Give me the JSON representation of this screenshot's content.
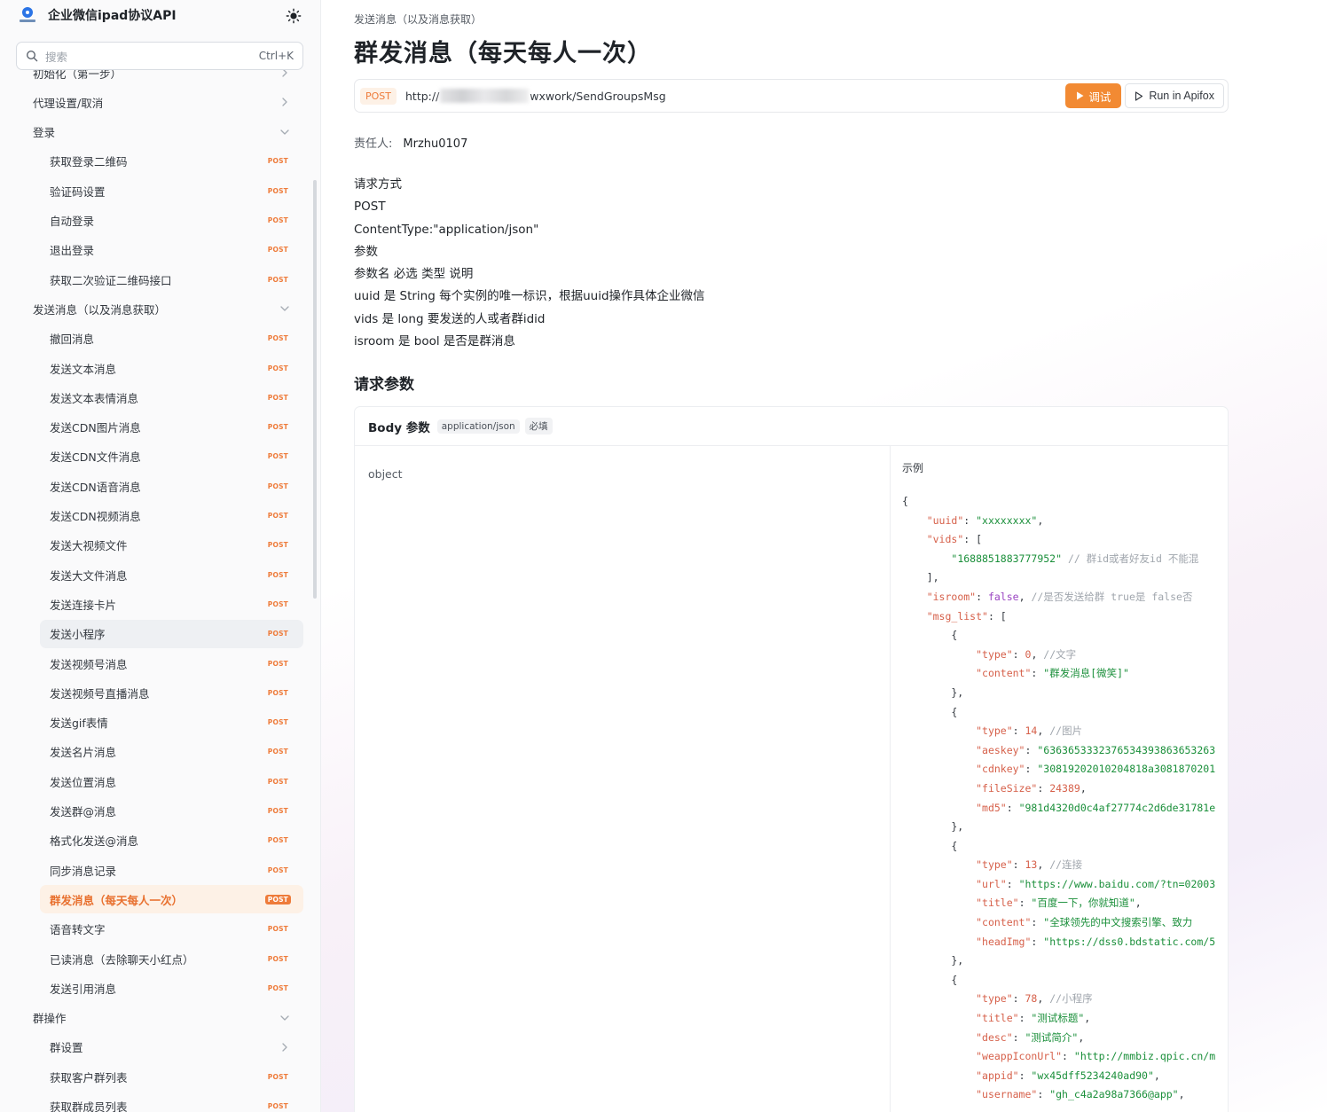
{
  "app": {
    "title": "企业微信ipad协议API"
  },
  "search": {
    "placeholder": "搜索",
    "shortcut": "Ctrl+K"
  },
  "sidebar": {
    "method_badge": "POST",
    "items": [
      {
        "label": "初始化（第一步）",
        "kind": "group",
        "chevron": "right"
      },
      {
        "label": "代理设置/取消",
        "kind": "group",
        "chevron": "right"
      },
      {
        "label": "登录",
        "kind": "group",
        "chevron": "down"
      },
      {
        "label": "获取登录二维码",
        "kind": "sub"
      },
      {
        "label": "验证码设置",
        "kind": "sub"
      },
      {
        "label": "自动登录",
        "kind": "sub"
      },
      {
        "label": "退出登录",
        "kind": "sub"
      },
      {
        "label": "获取二次验证二维码接口",
        "kind": "sub"
      },
      {
        "label": "发送消息（以及消息获取）",
        "kind": "group",
        "chevron": "down"
      },
      {
        "label": "撤回消息",
        "kind": "sub"
      },
      {
        "label": "发送文本消息",
        "kind": "sub"
      },
      {
        "label": "发送文本表情消息",
        "kind": "sub"
      },
      {
        "label": "发送CDN图片消息",
        "kind": "sub"
      },
      {
        "label": "发送CDN文件消息",
        "kind": "sub"
      },
      {
        "label": "发送CDN语音消息",
        "kind": "sub"
      },
      {
        "label": "发送CDN视频消息",
        "kind": "sub"
      },
      {
        "label": "发送大视频文件",
        "kind": "sub"
      },
      {
        "label": "发送大文件消息",
        "kind": "sub"
      },
      {
        "label": "发送连接卡片",
        "kind": "sub"
      },
      {
        "label": "发送小程序",
        "kind": "sub",
        "state": "hover"
      },
      {
        "label": "发送视频号消息",
        "kind": "sub"
      },
      {
        "label": "发送视频号直播消息",
        "kind": "sub"
      },
      {
        "label": "发送gif表情",
        "kind": "sub"
      },
      {
        "label": "发送名片消息",
        "kind": "sub"
      },
      {
        "label": "发送位置消息",
        "kind": "sub"
      },
      {
        "label": "发送群@消息",
        "kind": "sub"
      },
      {
        "label": "格式化发送@消息",
        "kind": "sub"
      },
      {
        "label": "同步消息记录",
        "kind": "sub"
      },
      {
        "label": "群发消息（每天每人一次）",
        "kind": "sub",
        "state": "active"
      },
      {
        "label": "语音转文字",
        "kind": "sub"
      },
      {
        "label": "已读消息（去除聊天小红点）",
        "kind": "sub"
      },
      {
        "label": "发送引用消息",
        "kind": "sub"
      },
      {
        "label": "群操作",
        "kind": "group",
        "chevron": "down"
      },
      {
        "label": "群设置",
        "kind": "subgroup",
        "chevron": "right"
      },
      {
        "label": "获取客户群列表",
        "kind": "sub"
      },
      {
        "label": "获取群成员列表",
        "kind": "sub"
      }
    ]
  },
  "page": {
    "breadcrumb": "发送消息（以及消息获取）",
    "title": "群发消息（每天每人一次）",
    "method": "POST",
    "url_prefix": "http://",
    "url_suffix": "wxwork/SendGroupsMsg",
    "test_button": "调试",
    "run_button": "Run in Apifox",
    "owner_label": "责任人:",
    "owner_name": "Mrzhu0107",
    "description": [
      "请求方式",
      "POST",
      "ContentType:\"application/json\"",
      "参数",
      "参数名 必选 类型 说明",
      "uuid 是 String 每个实例的唯一标识，根据uuid操作具体企业微信",
      "vids 是 long 要发送的人或者群idid",
      "isroom 是 bool 是否是群消息"
    ],
    "request_params_heading": "请求参数",
    "body": {
      "title": "Body 参数",
      "content_type": "application/json",
      "required": "必填",
      "object_label": "object",
      "example_title": "示例"
    }
  },
  "example_lines": [
    [
      [
        "p",
        "{"
      ]
    ],
    [
      [
        "p",
        "    "
      ],
      [
        "k",
        "\"uuid\""
      ],
      [
        "p",
        ": "
      ],
      [
        "s",
        "\"xxxxxxxx\""
      ],
      [
        "p",
        ","
      ]
    ],
    [
      [
        "p",
        "    "
      ],
      [
        "k",
        "\"vids\""
      ],
      [
        "p",
        ": ["
      ]
    ],
    [
      [
        "p",
        "        "
      ],
      [
        "s",
        "\"1688851883777952\""
      ],
      [
        "c",
        " // 群id或者好友id 不能混"
      ]
    ],
    [
      [
        "p",
        "    ],"
      ]
    ],
    [
      [
        "p",
        "    "
      ],
      [
        "k",
        "\"isroom\""
      ],
      [
        "p",
        ": "
      ],
      [
        "b",
        "false"
      ],
      [
        "p",
        ", "
      ],
      [
        "c",
        "//是否发送给群 true是 false否"
      ]
    ],
    [
      [
        "p",
        "    "
      ],
      [
        "k",
        "\"msg_list\""
      ],
      [
        "p",
        ": ["
      ]
    ],
    [
      [
        "p",
        "        {"
      ]
    ],
    [
      [
        "p",
        "            "
      ],
      [
        "k",
        "\"type\""
      ],
      [
        "p",
        ": "
      ],
      [
        "n",
        "0"
      ],
      [
        "p",
        ", "
      ],
      [
        "c",
        "//文字"
      ]
    ],
    [
      [
        "p",
        "            "
      ],
      [
        "k",
        "\"content\""
      ],
      [
        "p",
        ": "
      ],
      [
        "s",
        "\"群发消息[微笑]\""
      ]
    ],
    [
      [
        "p",
        "        },"
      ]
    ],
    [
      [
        "p",
        "        {"
      ]
    ],
    [
      [
        "p",
        "            "
      ],
      [
        "k",
        "\"type\""
      ],
      [
        "p",
        ": "
      ],
      [
        "n",
        "14"
      ],
      [
        "p",
        ", "
      ],
      [
        "c",
        "//图片"
      ]
    ],
    [
      [
        "p",
        "            "
      ],
      [
        "k",
        "\"aeskey\""
      ],
      [
        "p",
        ": "
      ],
      [
        "s",
        "\"6363653332376534393863653263"
      ]
    ],
    [
      [
        "p",
        "            "
      ],
      [
        "k",
        "\"cdnkey\""
      ],
      [
        "p",
        ": "
      ],
      [
        "s",
        "\"30819202010204818a3081870201"
      ]
    ],
    [
      [
        "p",
        "            "
      ],
      [
        "k",
        "\"fileSize\""
      ],
      [
        "p",
        ": "
      ],
      [
        "n",
        "24389"
      ],
      [
        "p",
        ","
      ]
    ],
    [
      [
        "p",
        "            "
      ],
      [
        "k",
        "\"md5\""
      ],
      [
        "p",
        ": "
      ],
      [
        "s",
        "\"981d4320d0c4af27774c2d6de31781e"
      ]
    ],
    [
      [
        "p",
        "        },"
      ]
    ],
    [
      [
        "p",
        "        {"
      ]
    ],
    [
      [
        "p",
        "            "
      ],
      [
        "k",
        "\"type\""
      ],
      [
        "p",
        ": "
      ],
      [
        "n",
        "13"
      ],
      [
        "p",
        ", "
      ],
      [
        "c",
        "//连接"
      ]
    ],
    [
      [
        "p",
        "            "
      ],
      [
        "k",
        "\"url\""
      ],
      [
        "p",
        ": "
      ],
      [
        "s",
        "\"https://www.baidu.com/?tn=02003"
      ]
    ],
    [
      [
        "p",
        "            "
      ],
      [
        "k",
        "\"title\""
      ],
      [
        "p",
        ": "
      ],
      [
        "s",
        "\"百度一下，你就知道\""
      ],
      [
        "p",
        ","
      ]
    ],
    [
      [
        "p",
        "            "
      ],
      [
        "k",
        "\"content\""
      ],
      [
        "p",
        ": "
      ],
      [
        "s",
        "\"全球领先的中文搜索引擎、致力"
      ]
    ],
    [
      [
        "p",
        "            "
      ],
      [
        "k",
        "\"headImg\""
      ],
      [
        "p",
        ": "
      ],
      [
        "s",
        "\"https://dss0.bdstatic.com/5"
      ]
    ],
    [
      [
        "p",
        "        },"
      ]
    ],
    [
      [
        "p",
        "        {"
      ]
    ],
    [
      [
        "p",
        "            "
      ],
      [
        "k",
        "\"type\""
      ],
      [
        "p",
        ": "
      ],
      [
        "n",
        "78"
      ],
      [
        "p",
        ", "
      ],
      [
        "c",
        "//小程序"
      ]
    ],
    [
      [
        "p",
        "            "
      ],
      [
        "k",
        "\"title\""
      ],
      [
        "p",
        ": "
      ],
      [
        "s",
        "\"测试标题\""
      ],
      [
        "p",
        ","
      ]
    ],
    [
      [
        "p",
        "            "
      ],
      [
        "k",
        "\"desc\""
      ],
      [
        "p",
        ": "
      ],
      [
        "s",
        "\"测试简介\""
      ],
      [
        "p",
        ","
      ]
    ],
    [
      [
        "p",
        "            "
      ],
      [
        "k",
        "\"weappIconUrl\""
      ],
      [
        "p",
        ": "
      ],
      [
        "s",
        "\"http://mmbiz.qpic.cn/m"
      ]
    ],
    [
      [
        "p",
        "            "
      ],
      [
        "k",
        "\"appid\""
      ],
      [
        "p",
        ": "
      ],
      [
        "s",
        "\"wx45dff5234240ad90\""
      ],
      [
        "p",
        ","
      ]
    ],
    [
      [
        "p",
        "            "
      ],
      [
        "k",
        "\"username\""
      ],
      [
        "p",
        ": "
      ],
      [
        "s",
        "\"gh_c4a2a98a7366@app\""
      ],
      [
        "p",
        ","
      ]
    ]
  ],
  "colors": {
    "accent": "#f28a33",
    "post_badge": "#ee7b3a",
    "active_bg": "#fdf1e6",
    "json_key": "#d6604a",
    "json_string": "#1a8f3a",
    "json_comment": "#a0a6ad",
    "json_bool": "#9a44c2"
  }
}
